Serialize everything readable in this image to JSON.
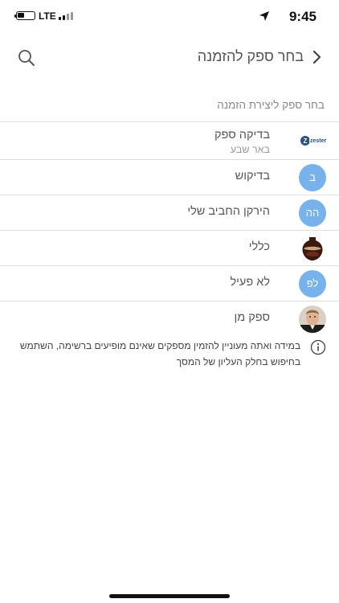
{
  "status_bar": {
    "time": "9:45",
    "network": "LTE"
  },
  "header": {
    "title": "בחר ספק להזמנה"
  },
  "section_label": "בחר ספק ליצירת הזמנה",
  "suppliers": [
    {
      "name": "בדיקה ספק",
      "subtitle": "באר שבע",
      "avatar_type": "logo",
      "logo_text": "zester"
    },
    {
      "name": "בדיקוש",
      "avatar_type": "initials",
      "initials": "ב"
    },
    {
      "name": "הירקן החביב שלי",
      "avatar_type": "initials",
      "initials": "הה"
    },
    {
      "name": "כללי",
      "avatar_type": "image",
      "icon": "vase-icon"
    },
    {
      "name": "לא פעיל",
      "avatar_type": "initials",
      "initials": "לפ"
    },
    {
      "name": "ספק מן",
      "avatar_type": "image",
      "icon": "person-photo-icon"
    }
  ],
  "info_text": "במידה ואתה מעוניין להזמין מספקים שאינם מופיעים ברשימה, השתמש בחיפוש בחלק העליון של המסך",
  "colors": {
    "initials_avatar": "#78b2ec",
    "divider": "#dedede"
  }
}
